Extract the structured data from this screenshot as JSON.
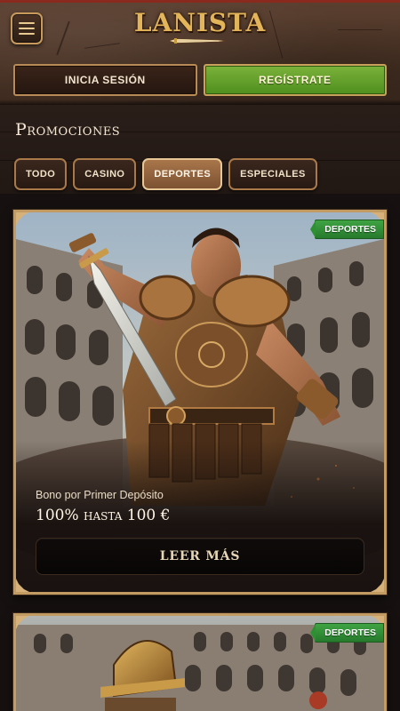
{
  "header": {
    "logo_text": "LANISTA",
    "login_label": "INICIA SESIÓN",
    "register_label": "REGÍSTRATE"
  },
  "promotions": {
    "title": "Promociones",
    "filters": [
      {
        "label": "TODO",
        "active": false
      },
      {
        "label": "CASINO",
        "active": false
      },
      {
        "label": "DEPORTES",
        "active": true
      },
      {
        "label": "ESPECIALES",
        "active": false
      }
    ]
  },
  "cards": [
    {
      "badge": "DEPORTES",
      "subtitle": "Bono por Primer Depósito",
      "title": "100% hasta 100 €",
      "button_label": "LEER MÁS"
    },
    {
      "badge": "DEPORTES"
    }
  ],
  "colors": {
    "accent_gold": "#c29b62",
    "register_green": "#5e9e27",
    "badge_green": "#2f8f33",
    "background": "#161110"
  }
}
